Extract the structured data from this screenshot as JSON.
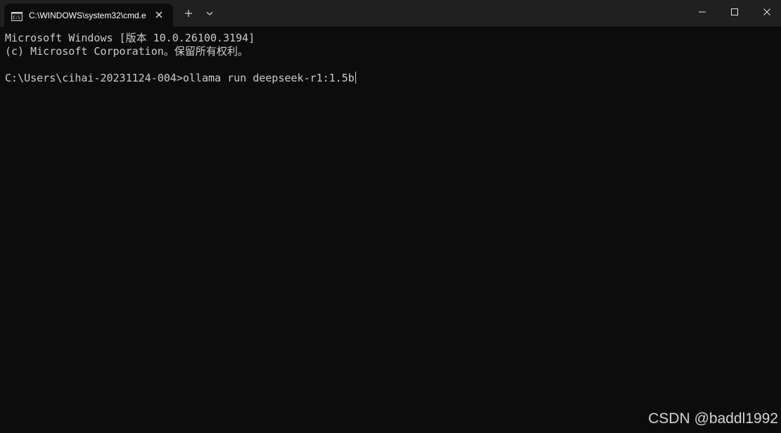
{
  "window": {
    "tab_title": "C:\\WINDOWS\\system32\\cmd.e",
    "tab_icon": "cmd-icon",
    "controls": [
      "minimize-icon",
      "maximize-icon",
      "close-icon"
    ]
  },
  "console": {
    "lines": [
      "Microsoft Windows [版本 10.0.26100.3194]",
      "(c) Microsoft Corporation。保留所有权利。",
      "C:\\Users\\cihai-20231124-004>ollama run deepseek-r1:1.5b"
    ]
  },
  "watermark": "CSDN @baddl1992",
  "colors": {
    "titlebar": "#202020",
    "console_bg": "#0c0c0c",
    "text": "#cccccc"
  }
}
